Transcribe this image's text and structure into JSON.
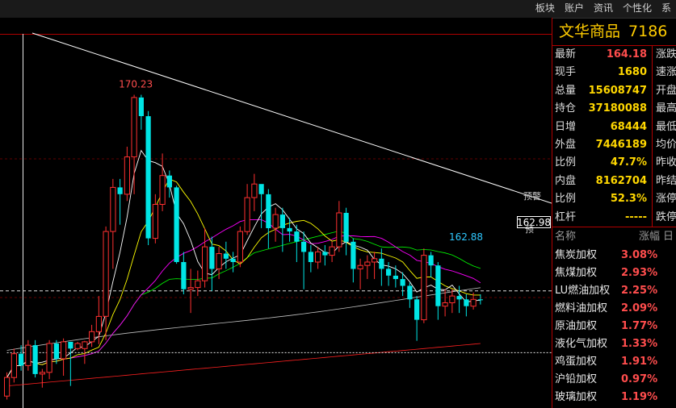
{
  "menu": [
    "板块",
    "账户",
    "资讯",
    "个性化",
    "系"
  ],
  "quote": {
    "name": "文华商品",
    "code": "7186",
    "rows": [
      {
        "label": "最新",
        "value": "164.18",
        "tone": "red",
        "right": "涨跌"
      },
      {
        "label": "现手",
        "value": "1680",
        "tone": "yellow",
        "right": "速涨"
      },
      {
        "label": "总量",
        "value": "15608747",
        "tone": "yellow",
        "right": "开盘"
      },
      {
        "label": "持仓",
        "value": "37180088",
        "tone": "yellow",
        "right": "最高"
      },
      {
        "label": "日增",
        "value": "68444",
        "tone": "yellow",
        "right": "最低"
      },
      {
        "label": "外盘",
        "value": "7446189",
        "tone": "yellow",
        "right": "均价"
      },
      {
        "label": "比例",
        "value": "47.7%",
        "tone": "yellow",
        "right": "昨收"
      },
      {
        "label": "内盘",
        "value": "8162704",
        "tone": "yellow",
        "right": "昨结"
      },
      {
        "label": "比例",
        "value": "52.3%",
        "tone": "yellow",
        "right": "涨停"
      },
      {
        "label": "杠杆",
        "value": "-----",
        "tone": "yellow",
        "right": "跌停"
      }
    ]
  },
  "sector_header": {
    "name": "名称",
    "change": "涨幅",
    "extra": "日"
  },
  "sectors": [
    {
      "name": "焦炭加权",
      "change": "3.08%"
    },
    {
      "name": "焦煤加权",
      "change": "2.93%"
    },
    {
      "name": "LU燃油加权",
      "change": "2.25%"
    },
    {
      "name": "燃料油加权",
      "change": "2.09%"
    },
    {
      "name": "原油加权",
      "change": "1.77%"
    },
    {
      "name": "液化气加权",
      "change": "1.33%"
    },
    {
      "name": "鸡蛋加权",
      "change": "1.91%"
    },
    {
      "name": "沪铅加权",
      "change": "0.97%"
    },
    {
      "name": "玻璃加权",
      "change": "1.19%"
    }
  ],
  "chart_data": {
    "type": "candlestick",
    "annotations": {
      "high": "170.23",
      "low": "162.88",
      "price_box": "162.98",
      "alert": "预警",
      "low_marker": "预"
    },
    "colors": {
      "up": "#ff3030",
      "down": "#00e5e5",
      "ma5": "#ffffff",
      "ma10": "#ffff00",
      "ma20": "#ff00ff",
      "ma40": "#00ff00",
      "ma60": "#c0c0c0",
      "ma120": "#ff2020"
    },
    "ylim": [
      161,
      172.5
    ],
    "candles": [
      [
        161.35,
        161.9,
        161.25,
        162.05
      ],
      [
        161.9,
        162.6,
        161.75,
        162.75
      ],
      [
        162.6,
        162.25,
        162.1,
        162.85
      ],
      [
        162.25,
        162.85,
        162.1,
        163.0
      ],
      [
        162.85,
        162.0,
        161.9,
        163.0
      ],
      [
        162.0,
        162.05,
        161.6,
        162.15
      ],
      [
        162.05,
        162.9,
        161.85,
        163.0
      ],
      [
        162.9,
        162.45,
        162.3,
        163.0
      ],
      [
        162.45,
        162.95,
        161.95,
        163.05
      ],
      [
        162.95,
        162.75,
        161.65,
        162.95
      ],
      [
        162.75,
        162.9,
        162.7,
        162.95
      ],
      [
        162.75,
        162.95,
        162.3,
        162.98
      ],
      [
        162.95,
        163.25,
        162.8,
        163.45
      ],
      [
        163.25,
        163.7,
        162.88,
        164.3
      ],
      [
        163.7,
        166.2,
        163.0,
        166.35
      ],
      [
        166.2,
        167.5,
        165.1,
        167.75
      ],
      [
        167.5,
        167.3,
        166.4,
        167.75
      ],
      [
        167.3,
        168.4,
        167.1,
        168.7
      ],
      [
        168.4,
        170.15,
        167.3,
        170.23
      ],
      [
        170.15,
        169.6,
        169.2,
        170.23
      ],
      [
        169.6,
        166.0,
        165.8,
        169.75
      ],
      [
        166.0,
        167.0,
        165.85,
        167.3
      ],
      [
        167.0,
        167.85,
        166.8,
        168.5
      ],
      [
        167.85,
        167.5,
        167.2,
        168.0
      ],
      [
        167.5,
        165.3,
        165.25,
        167.55
      ],
      [
        165.3,
        164.5,
        164.35,
        165.6
      ],
      [
        164.5,
        164.55,
        163.8,
        165.1
      ],
      [
        164.55,
        164.75,
        164.3,
        165.05
      ],
      [
        164.75,
        165.75,
        164.55,
        166.3
      ],
      [
        165.75,
        165.1,
        164.45,
        166.05
      ],
      [
        165.1,
        165.55,
        164.8,
        165.75
      ],
      [
        165.55,
        165.4,
        165.1,
        165.9
      ],
      [
        165.4,
        165.3,
        165.0,
        165.6
      ],
      [
        165.3,
        166.2,
        165.15,
        166.35
      ],
      [
        166.2,
        167.2,
        166.1,
        167.6
      ],
      [
        167.2,
        167.6,
        166.8,
        167.9
      ],
      [
        167.6,
        167.3,
        166.3,
        167.55
      ],
      [
        167.3,
        166.3,
        165.7,
        167.45
      ],
      [
        166.3,
        166.7,
        165.9,
        166.9
      ],
      [
        166.7,
        166.3,
        165.6,
        166.9
      ],
      [
        166.3,
        166.2,
        165.9,
        166.6
      ],
      [
        166.2,
        165.9,
        165.3,
        166.4
      ],
      [
        165.9,
        165.6,
        164.5,
        166.2
      ],
      [
        165.6,
        165.3,
        165.0,
        165.8
      ],
      [
        165.3,
        165.6,
        165.1,
        165.75
      ],
      [
        165.6,
        165.5,
        165.2,
        165.8
      ],
      [
        165.5,
        165.75,
        165.3,
        165.9
      ],
      [
        165.75,
        166.75,
        165.6,
        167.1
      ],
      [
        166.75,
        165.9,
        165.5,
        166.9
      ],
      [
        165.9,
        165.1,
        164.7,
        166.0
      ],
      [
        165.1,
        165.2,
        164.5,
        165.4
      ],
      [
        165.2,
        165.3,
        164.8,
        165.5
      ],
      [
        165.3,
        165.4,
        164.8,
        165.6
      ],
      [
        165.4,
        165.1,
        164.6,
        165.7
      ],
      [
        165.1,
        164.9,
        164.6,
        165.3
      ],
      [
        164.9,
        164.8,
        164.55,
        165.2
      ],
      [
        164.8,
        164.6,
        164.3,
        165.0
      ],
      [
        164.6,
        164.2,
        163.95,
        164.7
      ],
      [
        164.2,
        163.6,
        162.98,
        164.3
      ],
      [
        163.6,
        165.5,
        163.5,
        165.7
      ],
      [
        165.5,
        165.2,
        164.85,
        165.6
      ],
      [
        165.2,
        164.0,
        163.6,
        165.3
      ],
      [
        164.0,
        164.1,
        163.7,
        164.5
      ],
      [
        164.1,
        164.3,
        163.8,
        164.5
      ],
      [
        164.3,
        164.2,
        163.8,
        164.6
      ],
      [
        164.2,
        164.0,
        163.7,
        164.35
      ],
      [
        164.0,
        164.2,
        163.9,
        164.4
      ],
      [
        164.2,
        164.18,
        164.05,
        164.35
      ]
    ]
  }
}
